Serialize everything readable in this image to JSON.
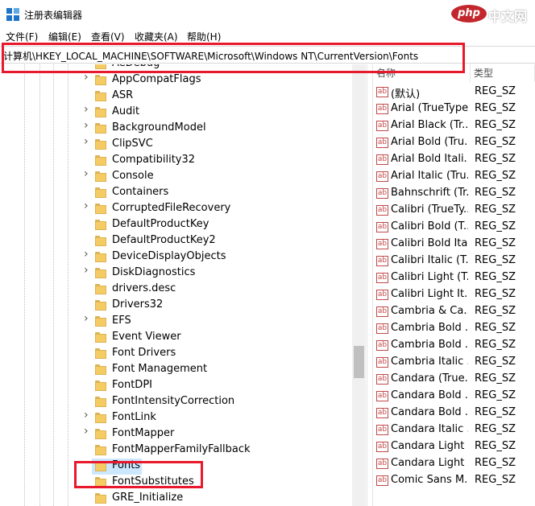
{
  "window": {
    "title": "注册表编辑器",
    "watermark": {
      "logo": "php",
      "text": "中文网"
    }
  },
  "menu": [
    "文件(F)",
    "编辑(E)",
    "查看(V)",
    "收藏夹(A)",
    "帮助(H)"
  ],
  "address": "计算机\\HKEY_LOCAL_MACHINE\\SOFTWARE\\Microsoft\\Windows NT\\CurrentVersion\\Fonts",
  "tree": {
    "items": [
      {
        "label": "AeDebug",
        "expandable": true
      },
      {
        "label": "AppCompatFlags",
        "expandable": true
      },
      {
        "label": "ASR",
        "expandable": false
      },
      {
        "label": "Audit",
        "expandable": true
      },
      {
        "label": "BackgroundModel",
        "expandable": true
      },
      {
        "label": "ClipSVC",
        "expandable": true
      },
      {
        "label": "Compatibility32",
        "expandable": false
      },
      {
        "label": "Console",
        "expandable": true
      },
      {
        "label": "Containers",
        "expandable": false
      },
      {
        "label": "CorruptedFileRecovery",
        "expandable": true
      },
      {
        "label": "DefaultProductKey",
        "expandable": false
      },
      {
        "label": "DefaultProductKey2",
        "expandable": false
      },
      {
        "label": "DeviceDisplayObjects",
        "expandable": true
      },
      {
        "label": "DiskDiagnostics",
        "expandable": true
      },
      {
        "label": "drivers.desc",
        "expandable": false
      },
      {
        "label": "Drivers32",
        "expandable": false
      },
      {
        "label": "EFS",
        "expandable": true
      },
      {
        "label": "Event Viewer",
        "expandable": false
      },
      {
        "label": "Font Drivers",
        "expandable": false
      },
      {
        "label": "Font Management",
        "expandable": false
      },
      {
        "label": "FontDPI",
        "expandable": false
      },
      {
        "label": "FontIntensityCorrection",
        "expandable": false
      },
      {
        "label": "FontLink",
        "expandable": true
      },
      {
        "label": "FontMapper",
        "expandable": true
      },
      {
        "label": "FontMapperFamilyFallback",
        "expandable": false
      },
      {
        "label": "Fonts",
        "expandable": false,
        "selected": true
      },
      {
        "label": "FontSubstitutes",
        "expandable": false
      },
      {
        "label": "GRE_Initialize",
        "expandable": false
      }
    ]
  },
  "values": {
    "columns": {
      "name": "名称",
      "type": "类型"
    },
    "rows": [
      {
        "name": "(默认)",
        "type": "REG_SZ"
      },
      {
        "name": "Arial (TrueType)",
        "type": "REG_SZ"
      },
      {
        "name": "Arial Black (Tr...",
        "type": "REG_SZ"
      },
      {
        "name": "Arial Bold (Tru...",
        "type": "REG_SZ"
      },
      {
        "name": "Arial Bold Itali...",
        "type": "REG_SZ"
      },
      {
        "name": "Arial Italic (Tru...",
        "type": "REG_SZ"
      },
      {
        "name": "Bahnschrift (Tr...",
        "type": "REG_SZ"
      },
      {
        "name": "Calibri (TrueTy...",
        "type": "REG_SZ"
      },
      {
        "name": "Calibri Bold (T...",
        "type": "REG_SZ"
      },
      {
        "name": "Calibri Bold Ita...",
        "type": "REG_SZ"
      },
      {
        "name": "Calibri Italic (T...",
        "type": "REG_SZ"
      },
      {
        "name": "Calibri Light (T...",
        "type": "REG_SZ"
      },
      {
        "name": "Calibri Light It...",
        "type": "REG_SZ"
      },
      {
        "name": "Cambria & Ca...",
        "type": "REG_SZ"
      },
      {
        "name": "Cambria Bold ...",
        "type": "REG_SZ"
      },
      {
        "name": "Cambria Bold ...",
        "type": "REG_SZ"
      },
      {
        "name": "Cambria Italic ...",
        "type": "REG_SZ"
      },
      {
        "name": "Candara (True...",
        "type": "REG_SZ"
      },
      {
        "name": "Candara Bold ...",
        "type": "REG_SZ"
      },
      {
        "name": "Candara Bold ...",
        "type": "REG_SZ"
      },
      {
        "name": "Candara Italic ...",
        "type": "REG_SZ"
      },
      {
        "name": "Candara Light ...",
        "type": "REG_SZ"
      },
      {
        "name": "Candara Light ...",
        "type": "REG_SZ"
      },
      {
        "name": "Comic Sans M...",
        "type": "REG_SZ"
      }
    ],
    "icon_label": "ab"
  },
  "colors": {
    "highlight": "#e8192c",
    "selection": "#cce8ff",
    "folder": "#f5cc63"
  }
}
